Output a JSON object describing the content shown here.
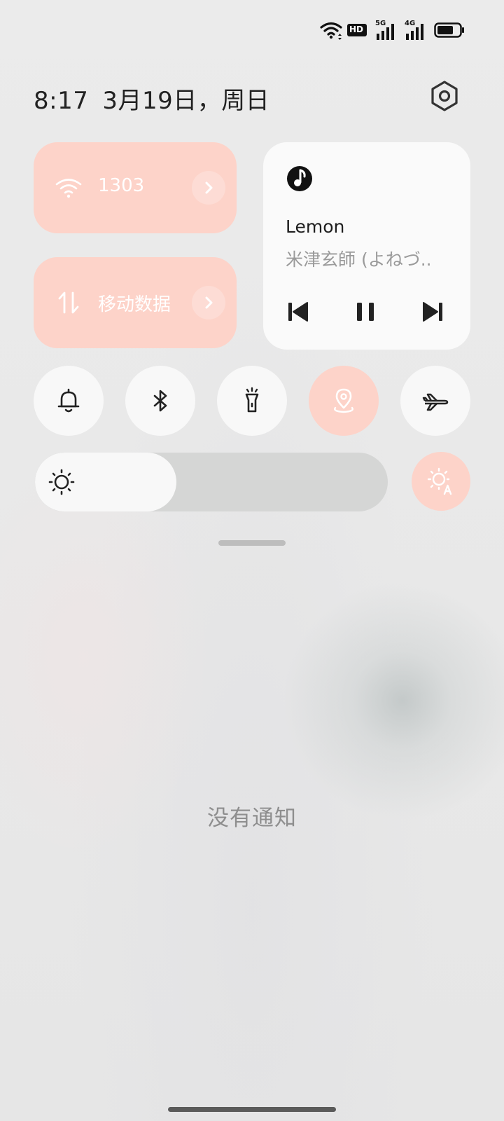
{
  "status_bar": {
    "icons": [
      "wifi-icon",
      "hd-icon",
      "5g-signal-icon",
      "4g-signal-icon",
      "battery-icon"
    ],
    "hd_label": "HD",
    "net1": "5G",
    "net2": "4G",
    "battery_level": 0.7
  },
  "header": {
    "time": "8:17",
    "date": "3月19日，周日"
  },
  "tiles": {
    "wifi": {
      "label": "1303"
    },
    "mobile_data": {
      "label": "移动数据"
    }
  },
  "media": {
    "title": "Lemon",
    "artist": "米津玄師 (よねづ.."
  },
  "toggles": [
    {
      "name": "ring-mode",
      "icon": "bell-icon",
      "active": false
    },
    {
      "name": "bluetooth",
      "icon": "bluetooth-icon",
      "active": false
    },
    {
      "name": "flashlight",
      "icon": "flashlight-icon",
      "active": false
    },
    {
      "name": "location",
      "icon": "location-pin-icon",
      "active": true
    },
    {
      "name": "airplane-mode",
      "icon": "airplane-icon",
      "active": false
    }
  ],
  "brightness": {
    "level": 0.4,
    "auto_enabled": true
  },
  "notifications": {
    "empty_text": "没有通知"
  },
  "colors": {
    "accent": "#fdd3c9",
    "card": "#fafafa",
    "text_primary": "#222222",
    "text_secondary": "#9a9a9a"
  }
}
